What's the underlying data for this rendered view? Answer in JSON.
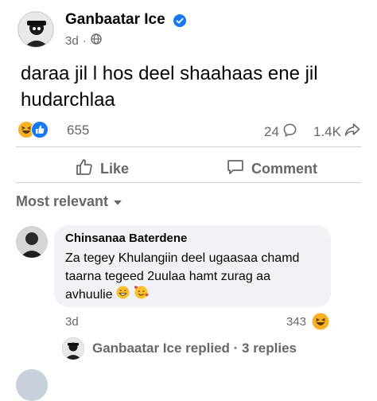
{
  "post": {
    "author": "Ganbaatar Ice",
    "time": "3d",
    "text": "daraa jil l hos deel shaahaas ene jil hudarchlaa",
    "reaction_count": "655",
    "comment_count": "24",
    "share_count": "1.4K"
  },
  "actions": {
    "like_label": "Like",
    "comment_label": "Comment"
  },
  "sort": {
    "label": "Most relevant"
  },
  "comment": {
    "author": "Chinsanaa Baterdene",
    "text": "Za tegey Khulangiin deel ugaasaa chamd taarna tegeed 2uulaa hamt zurag aa avhuulie",
    "time": "3d",
    "reaction_count": "343"
  },
  "replies": {
    "label": "Ganbaatar Ice replied · 3 replies"
  },
  "colors": {
    "brand_blue": "#1877f2",
    "muted": "#65676b",
    "bubble": "#f0f2f5"
  },
  "icons": {
    "verified": "verified-badge-icon",
    "globe": "globe-icon",
    "like": "thumbs-up-icon",
    "comment": "comment-icon",
    "share": "share-icon",
    "haha": "haha-reaction-icon"
  }
}
